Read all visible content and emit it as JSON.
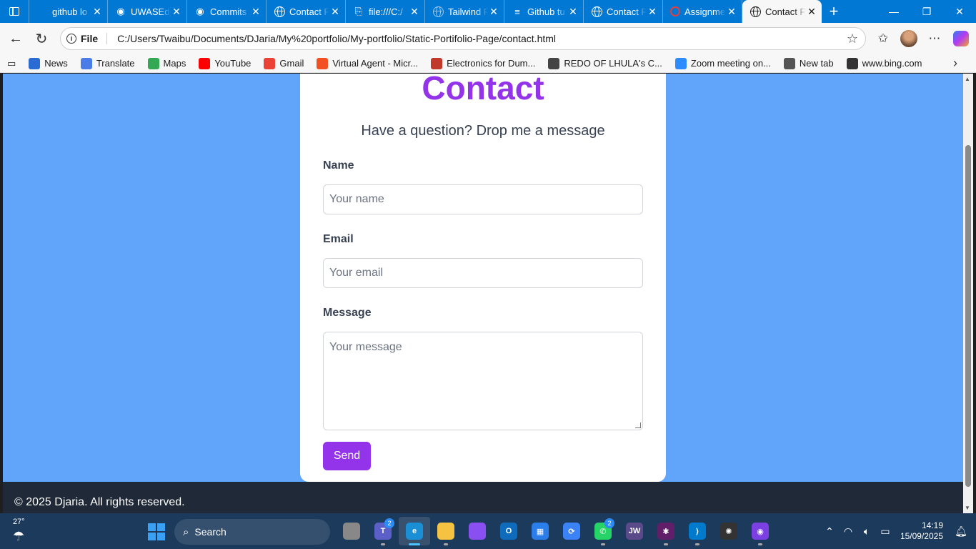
{
  "browser": {
    "tabs": [
      {
        "label": "github lo",
        "icon": "blank"
      },
      {
        "label": "UWASEdj",
        "icon": "github"
      },
      {
        "label": "Commits",
        "icon": "github"
      },
      {
        "label": "Contact F",
        "icon": "globe"
      },
      {
        "label": "file:///C:/",
        "icon": "file"
      },
      {
        "label": "Tailwind F",
        "icon": "globe-faded"
      },
      {
        "label": "Github tu",
        "icon": "doc"
      },
      {
        "label": "Contact F",
        "icon": "globe"
      },
      {
        "label": "Assignme",
        "icon": "loading"
      },
      {
        "label": "Contact F",
        "icon": "globe",
        "active": true
      }
    ],
    "address": {
      "scheme": "File",
      "url": "C:/Users/Twaibu/Documents/DJaria/My%20portfolio/My-portfolio/Static-Portifolio-Page/contact.html"
    },
    "favorites": [
      {
        "label": "News",
        "color": "#2b6cd4"
      },
      {
        "label": "Translate",
        "color": "#4a7de8"
      },
      {
        "label": "Maps",
        "color": "#34a853"
      },
      {
        "label": "YouTube",
        "color": "#ff0000"
      },
      {
        "label": "Gmail",
        "color": "#ea4335"
      },
      {
        "label": "Virtual Agent - Micr...",
        "color": "#f25022"
      },
      {
        "label": "Electronics for Dum...",
        "color": "#c0392b"
      },
      {
        "label": "REDO OF LHULA's C...",
        "color": "#444444"
      },
      {
        "label": "Zoom meeting on...",
        "color": "#2d8cff"
      },
      {
        "label": "New tab",
        "color": "#555555"
      },
      {
        "label": "www.bing.com",
        "color": "#333333"
      }
    ]
  },
  "page": {
    "title": "Contact",
    "subtitle": "Have a question? Drop me a message",
    "form": {
      "name_label": "Name",
      "name_placeholder": "Your name",
      "email_label": "Email",
      "email_placeholder": "Your email",
      "message_label": "Message",
      "message_placeholder": "Your message",
      "send_label": "Send"
    },
    "footer": "© 2025 Djaria. All rights reserved.",
    "colors": {
      "background": "#60a5fa",
      "accent": "#9333ea",
      "footer": "#1f2937"
    }
  },
  "taskbar": {
    "weather": "27°",
    "search_placeholder": "Search",
    "apps": [
      {
        "name": "task-view",
        "color": "#888888",
        "glyph": ""
      },
      {
        "name": "teams",
        "color": "#5b5fc7",
        "glyph": "T",
        "badge": "2"
      },
      {
        "name": "edge",
        "color": "#1a8fd6",
        "glyph": "e",
        "active": true
      },
      {
        "name": "file-explorer",
        "color": "#f5c242",
        "glyph": ""
      },
      {
        "name": "copilot",
        "color": "#8a4ff0",
        "glyph": ""
      },
      {
        "name": "outlook",
        "color": "#0f6cbd",
        "glyph": "O"
      },
      {
        "name": "store",
        "color": "#2b7de9",
        "glyph": "▦"
      },
      {
        "name": "sync-app",
        "color": "#3b82f6",
        "glyph": "⟳"
      },
      {
        "name": "whatsapp",
        "color": "#25d366",
        "glyph": "✆",
        "badge": "2"
      },
      {
        "name": "jw-library",
        "color": "#5a4a8a",
        "glyph": "JW"
      },
      {
        "name": "slack",
        "color": "#611f69",
        "glyph": "✱"
      },
      {
        "name": "vscode",
        "color": "#007acc",
        "glyph": "⟩"
      },
      {
        "name": "chatgpt",
        "color": "#333333",
        "glyph": "✺"
      },
      {
        "name": "github-desktop",
        "color": "#7b3fe4",
        "glyph": "◉"
      }
    ],
    "time": "14:19",
    "date": "15/09/2025"
  }
}
